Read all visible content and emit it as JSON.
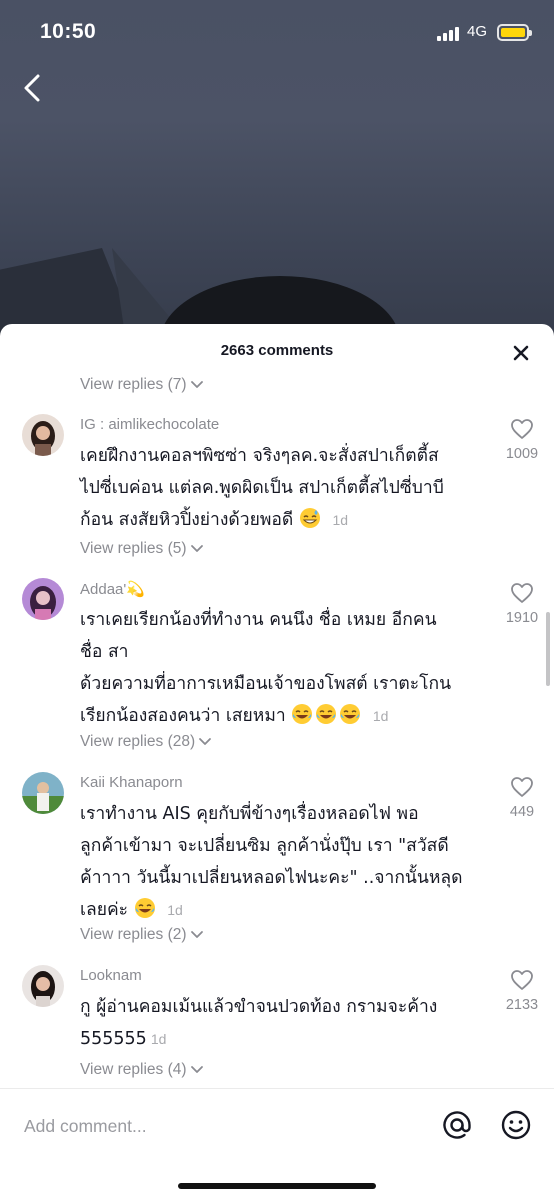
{
  "status_bar": {
    "time": "10:50",
    "network": "4G"
  },
  "header": {
    "comment_count": "2663 comments"
  },
  "colors": {
    "sheet_bg": "#ffffff",
    "secondary_text": "#8a8b91",
    "battery": "#ffd60a"
  },
  "replies_top": {
    "label": "View replies (7)"
  },
  "comments": [
    {
      "username": "IG : aimlikechocolate",
      "lines": [
        "เคยฝึกงานคอลฯพิซซ่า จริงๆลค.จะสั่งสปาเก็ตตี้ส",
        "ไปซี่เบค่อน แต่ลค.พูดผิดเป็น สปาเก็ตตี้สไปซี่บาบี",
        "ก้อน สงสัยหิวปิ้งย่างด้วยพอดี"
      ],
      "emoji": "grinning-sweat-emoji",
      "time": "1d",
      "likes": "1009",
      "replies": "View replies (5)"
    },
    {
      "username": "Addaa'💫",
      "lines": [
        "เราเคยเรียกน้องที่ทำงาน คนนึง ชื่อ เหมย อีกคน",
        "ชื่อ สา",
        "ด้วยความที่อาการเหมือนเจ้าของโพสต์ เราตะโกน",
        "เรียกน้องสองคนว่า เสยหมา"
      ],
      "emoji": "tears-of-joy-emoji",
      "time": "1d",
      "likes": "1910",
      "replies": "View replies (28)"
    },
    {
      "username": "Kaii Khanaporn",
      "lines": [
        "เราทำงาน AIS คุยกับพี่ข้างๆเรื่องหลอดไฟ พอ",
        "ลูกค้าเข้ามา จะเปลี่ยนซิม ลูกค้านั่งปุ๊บ เรา \"สวัสดี",
        "ค้าาาา วันนี้มาเปลี่ยนหลอดไฟนะคะ\" ..จากนั้นหลุด",
        "เลยค่ะ"
      ],
      "emoji": "tears-of-joy-emoji",
      "time": "1d",
      "likes": "449",
      "replies": "View replies (2)"
    },
    {
      "username": "Looknam",
      "lines": [
        "กู ผู้อ่านคอมเม้นแล้วขำจนปวดท้อง กรามจะค้าง",
        "555555"
      ],
      "emoji": "",
      "time": "1d",
      "likes": "2133",
      "replies": "View replies (4)"
    }
  ],
  "input": {
    "placeholder": "Add comment..."
  }
}
